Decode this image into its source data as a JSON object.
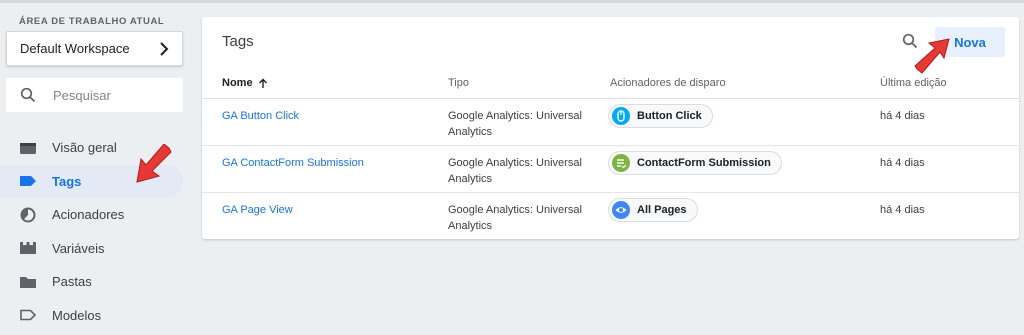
{
  "sidebar": {
    "workspace_label": "ÁREA DE TRABALHO ATUAL",
    "workspace_name": "Default Workspace",
    "search_placeholder": "Pesquisar",
    "items": [
      {
        "label": "Visão geral",
        "icon": "overview-icon"
      },
      {
        "label": "Tags",
        "icon": "tag-icon",
        "active": true
      },
      {
        "label": "Acionadores",
        "icon": "trigger-icon"
      },
      {
        "label": "Variáveis",
        "icon": "variable-icon"
      },
      {
        "label": "Pastas",
        "icon": "folder-icon"
      },
      {
        "label": "Modelos",
        "icon": "template-icon"
      }
    ]
  },
  "main": {
    "title": "Tags",
    "new_button": "Nova",
    "columns": {
      "name": "Nome",
      "type": "Tipo",
      "triggers": "Acionadores de disparo",
      "edited": "Última edição"
    },
    "rows": [
      {
        "name": "GA Button Click",
        "type": "Google Analytics: Universal Analytics",
        "trigger": "Button Click",
        "trigger_icon": "click-icon",
        "trigger_color": "#03a9f4",
        "edited": "há 4 dias"
      },
      {
        "name": "GA ContactForm Submission",
        "type": "Google Analytics: Universal Analytics",
        "trigger": "ContactForm Submission",
        "trigger_icon": "form-icon",
        "trigger_color": "#7cb342",
        "edited": "há 4 dias"
      },
      {
        "name": "GA Page View",
        "type": "Google Analytics: Universal Analytics",
        "trigger": "All Pages",
        "trigger_icon": "eye-icon",
        "trigger_color": "#4285f4",
        "edited": "há 4 dias"
      }
    ]
  },
  "colors": {
    "accent": "#1a73e8",
    "annotation_arrow": "#e53935"
  }
}
